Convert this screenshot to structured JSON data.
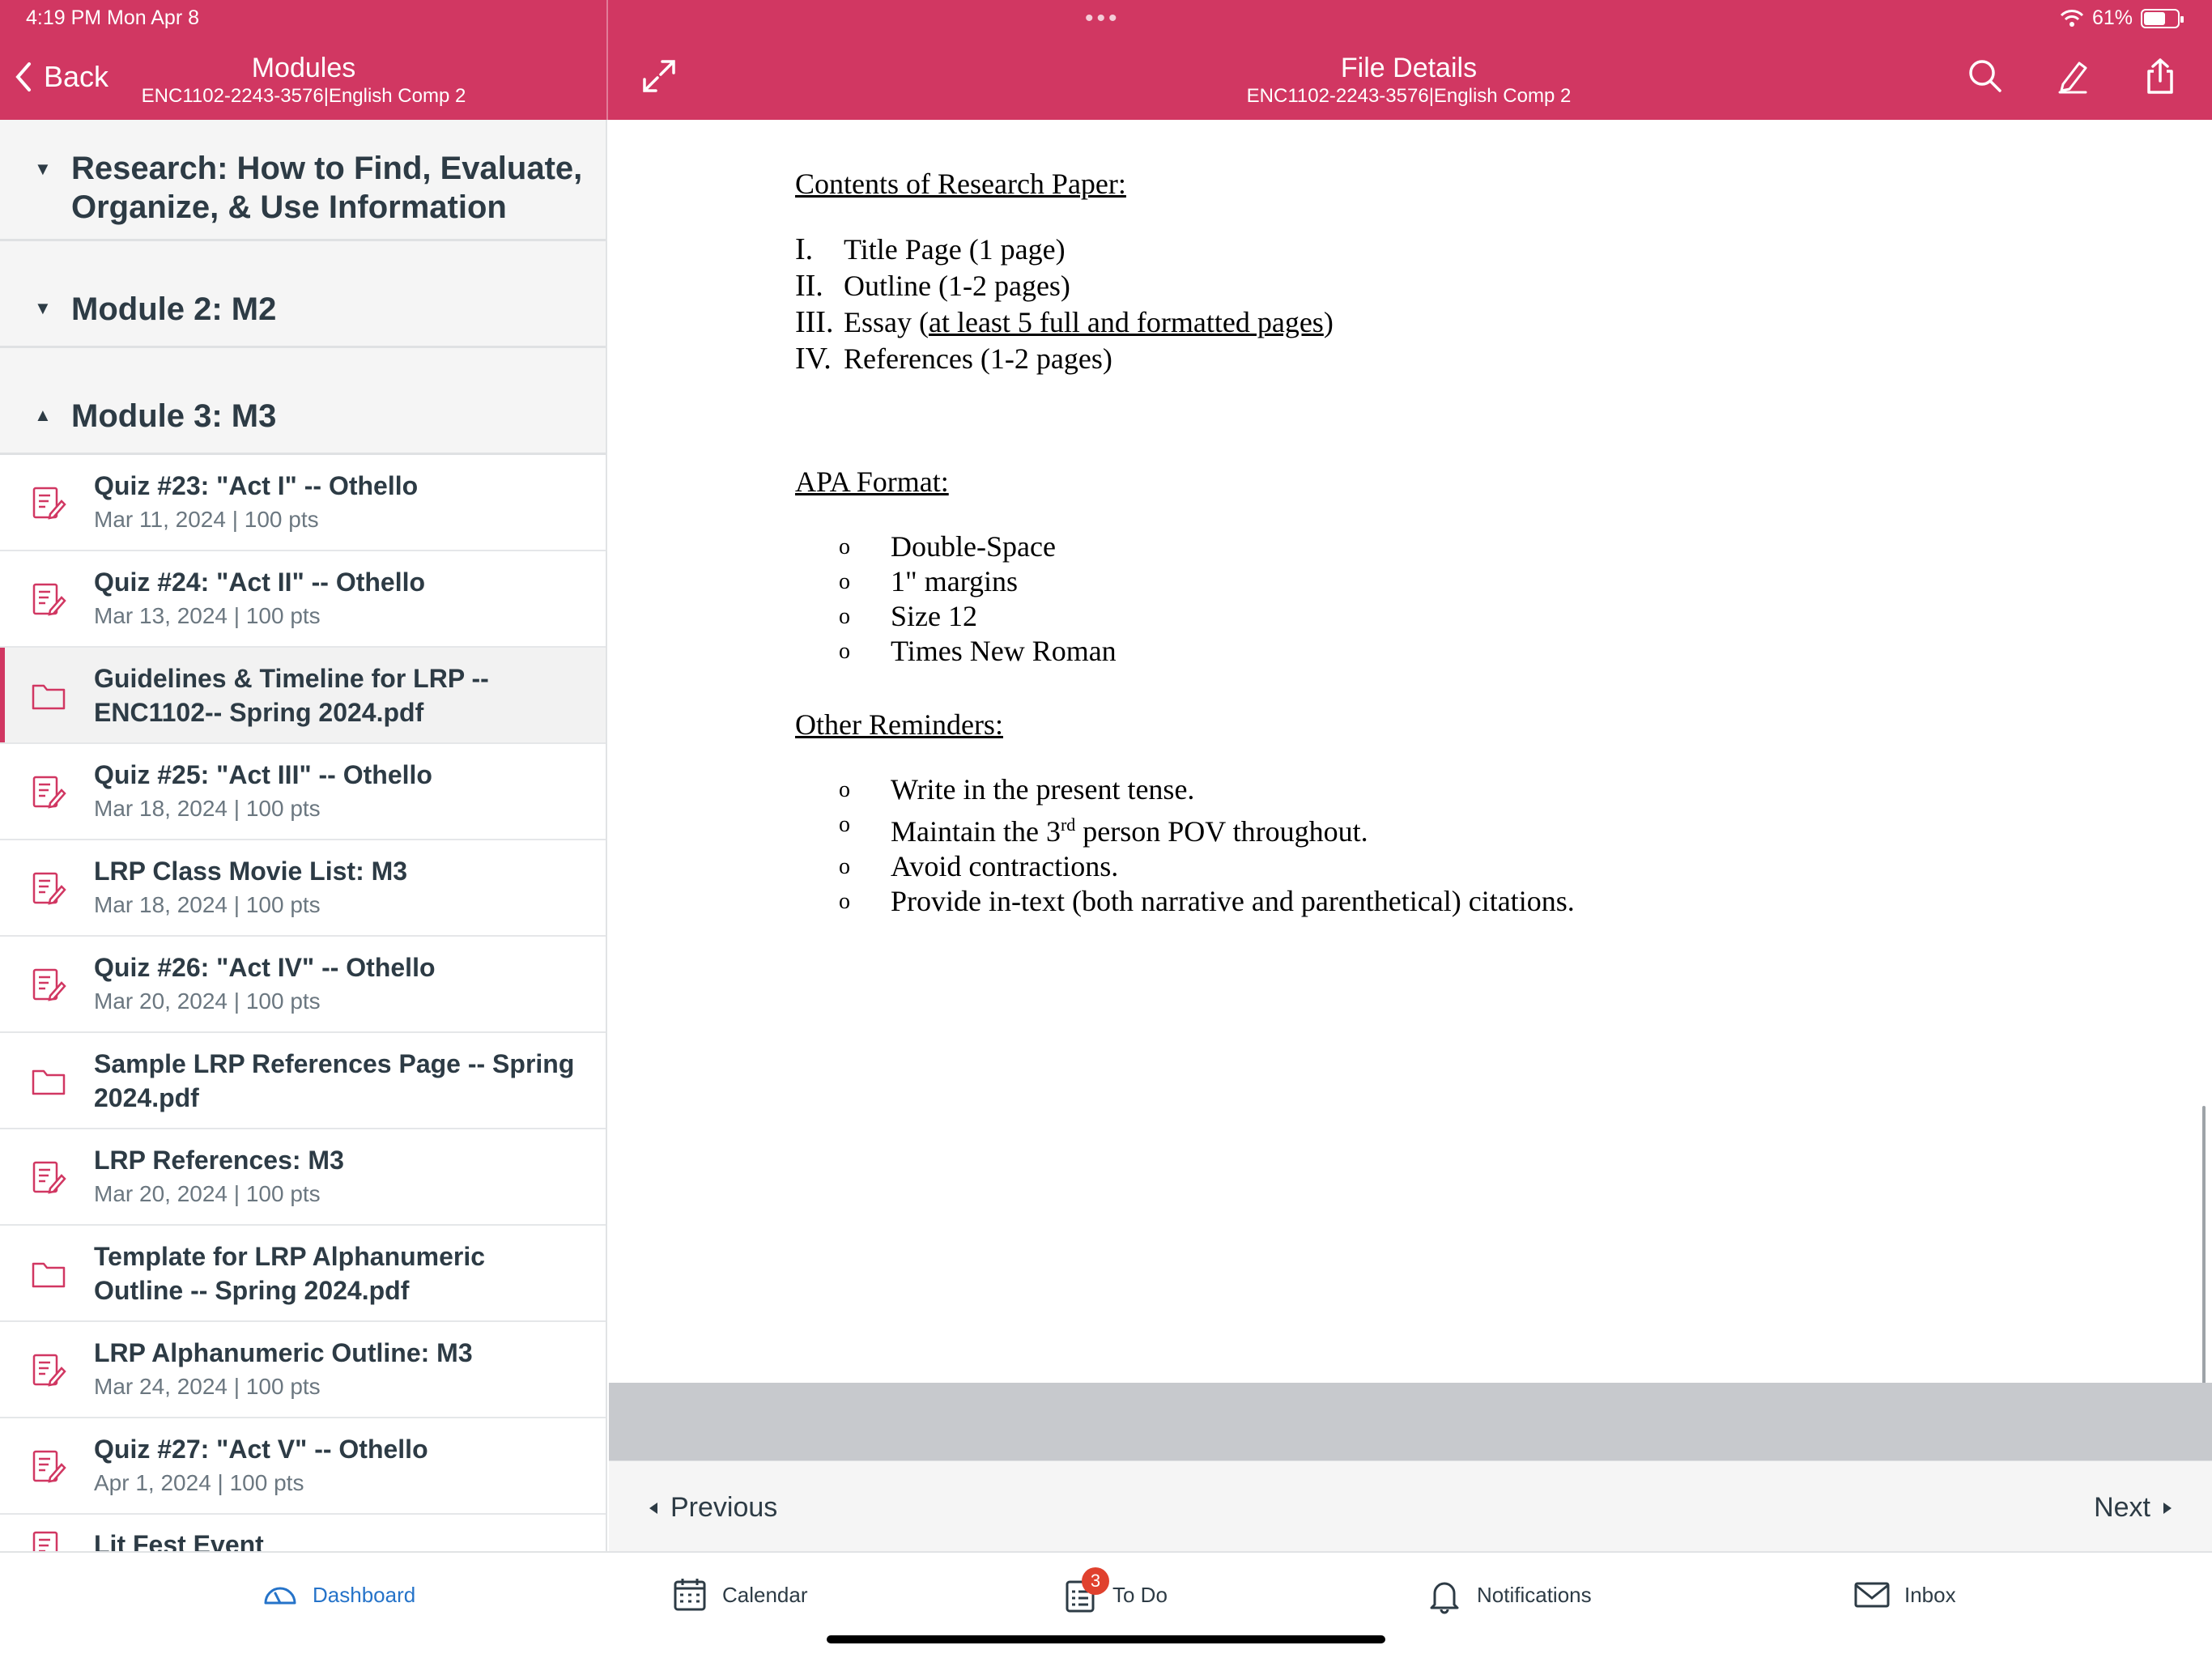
{
  "status": {
    "time": "4:19 PM  Mon Apr 8",
    "battery": "61%"
  },
  "left_header": {
    "back_label": "Back",
    "title": "Modules",
    "subtitle": "ENC1102-2243-3576|English Comp 2"
  },
  "right_header": {
    "title": "File Details",
    "subtitle": "ENC1102-2243-3576|English Comp 2"
  },
  "sidebar": {
    "sections": [
      {
        "title_line1": "Research: How to Find, Evaluate,",
        "title_line2": "Organize, & Use Information",
        "expanded": false
      },
      {
        "title": "Module 2: M2",
        "expanded": false
      },
      {
        "title": "Module 3: M3",
        "expanded": true
      }
    ],
    "items": [
      {
        "title": "Quiz #23: \"Act I\" -- Othello",
        "meta": "Mar 11, 2024 | 100 pts",
        "icon": "quiz-icon"
      },
      {
        "title": "Quiz #24: \"Act II\" -- Othello",
        "meta": "Mar 13, 2024 | 100 pts",
        "icon": "quiz-icon"
      },
      {
        "title_line1": "Guidelines & Timeline for LRP --",
        "title_line2": "ENC1102-- Spring 2024.pdf",
        "icon": "folder-icon",
        "selected": true
      },
      {
        "title": "Quiz #25: \"Act III\" -- Othello",
        "meta": "Mar 18, 2024 | 100 pts",
        "icon": "quiz-icon"
      },
      {
        "title": "LRP Class Movie List: M3",
        "meta": "Mar 18, 2024 | 100 pts",
        "icon": "assignment-icon"
      },
      {
        "title": "Quiz #26: \"Act IV\" -- Othello",
        "meta": "Mar 20, 2024 | 100 pts",
        "icon": "quiz-icon"
      },
      {
        "title_line1": "Sample LRP References Page -- Spring",
        "title_line2": "2024.pdf",
        "icon": "folder-icon"
      },
      {
        "title": "LRP References: M3",
        "meta": "Mar 20, 2024 | 100 pts",
        "icon": "assignment-icon"
      },
      {
        "title_line1": "Template for LRP Alphanumeric",
        "title_line2": "Outline -- Spring 2024.pdf",
        "icon": "folder-icon"
      },
      {
        "title": "LRP Alphanumeric Outline: M3",
        "meta": "Mar 24, 2024 | 100 pts",
        "icon": "assignment-icon"
      },
      {
        "title": "Quiz #27: \"Act V\" -- Othello",
        "meta": "Apr 1, 2024 | 100 pts",
        "icon": "quiz-icon"
      },
      {
        "title": "Lit Fest Event",
        "icon": "assignment-icon"
      }
    ]
  },
  "document": {
    "contents_heading": "Contents of Research Paper:",
    "contents": [
      {
        "num": "I.",
        "text": "Title Page (1 page)"
      },
      {
        "num": "II.",
        "text": "Outline (1-2 pages)"
      },
      {
        "num": "III.",
        "text_pre": "Essay (",
        "text_underlined": "at least 5 full and formatted pages",
        "text_post": ")"
      },
      {
        "num": "IV.",
        "text": "References (1-2 pages)"
      }
    ],
    "apa_heading": "APA Format:",
    "apa": [
      "Double-Space",
      "1\" margins",
      "Size 12",
      "Times New Roman"
    ],
    "reminders_heading": "Other Reminders:",
    "reminders": [
      {
        "text": "Write in the present tense."
      },
      {
        "text_pre": "Maintain the 3",
        "sup": "rd",
        "text_post": " person POV throughout."
      },
      {
        "text": "Avoid contractions."
      },
      {
        "text": "Provide in-text (both narrative and parenthetical) citations."
      }
    ],
    "bullet": "o"
  },
  "pager": {
    "previous": "Previous",
    "next": "Next"
  },
  "tabs": [
    {
      "label": "Dashboard",
      "icon": "dashboard-icon",
      "active": true
    },
    {
      "label": "Calendar",
      "icon": "calendar-icon"
    },
    {
      "label": "To Do",
      "icon": "todo-icon",
      "badge": "3"
    },
    {
      "label": "Notifications",
      "icon": "bell-icon"
    },
    {
      "label": "Inbox",
      "icon": "inbox-icon"
    }
  ],
  "colors": {
    "brand": "#d13762",
    "active_tab": "#2573c9",
    "badge": "#e0412e"
  }
}
